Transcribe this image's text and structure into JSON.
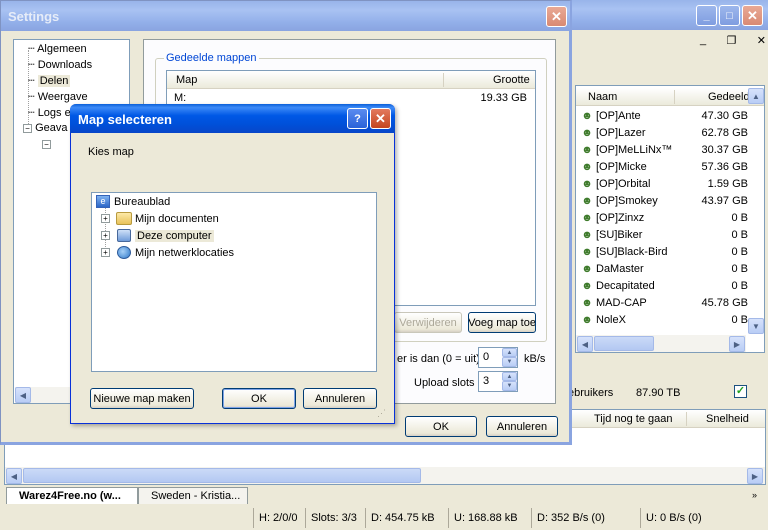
{
  "main_window": {
    "title": "",
    "minimize": "_",
    "maximize": "□",
    "close": "✕",
    "mdi": {
      "minimize": "_",
      "restore": "❐",
      "close": "✕"
    },
    "users_header": {
      "name": "Naam",
      "shared": "Gedeeld"
    },
    "users": [
      {
        "name": "[OP]Ante",
        "shared": "47.30 GB"
      },
      {
        "name": "[OP]Lazer",
        "shared": "62.78 GB"
      },
      {
        "name": "[OP]MeLLiNx™",
        "shared": "30.37 GB"
      },
      {
        "name": "[OP]Micke",
        "shared": "57.36 GB"
      },
      {
        "name": "[OP]Orbital",
        "shared": "1.59 GB"
      },
      {
        "name": "[OP]Smokey",
        "shared": "43.97 GB"
      },
      {
        "name": "[OP]Zinxz",
        "shared": "0 B"
      },
      {
        "name": "[SU]Biker",
        "shared": "0 B"
      },
      {
        "name": "[SU]Black-Bird",
        "shared": "0 B"
      },
      {
        "name": "DaMaster",
        "shared": "0 B"
      },
      {
        "name": "Decapitated",
        "shared": "0 B"
      },
      {
        "name": "MAD-CAP",
        "shared": "45.78 GB"
      },
      {
        "name": "NoleX",
        "shared": "0 B"
      }
    ],
    "hub_users_label": "ebruikers",
    "hub_total": "87.90 TB",
    "transfer_cols": {
      "time_left": "Tijd nog te gaan",
      "speed": "Snelheid"
    },
    "tabs": [
      "Warez4Free.no (w...",
      "Sweden - Kristia..."
    ],
    "status": {
      "hubs": "H: 2/0/0",
      "slots": "Slots: 3/3",
      "down": "D: 454.75 kB",
      "up": "U: 168.88 kB",
      "down_rate": "D: 352 B/s (0)",
      "up_rate": "U: 0 B/s (0)"
    }
  },
  "settings": {
    "title": "Settings",
    "nav": [
      "Algemeen",
      "Downloads",
      "Delen",
      "Weergave",
      "Logs e",
      "Geava"
    ],
    "shared_group": "Gedeelde mappen",
    "table_headers": {
      "map": "Map",
      "size": "Grootte"
    },
    "rows": [
      {
        "map": "M:",
        "size": "19.33 GB"
      }
    ],
    "remove_button": "Verwijderen",
    "add_button": "Voeg map toe",
    "speed_label": "er is dan (0 = uit)",
    "speed_value": "0",
    "speed_unit": "kB/s",
    "slots_label": "Upload slots",
    "slots_value": "3",
    "ok": "OK",
    "cancel": "Annuleren"
  },
  "dialog": {
    "title": "Map selecteren",
    "help": "?",
    "close": "✕",
    "prompt": "Kies map",
    "tree": [
      "Bureaublad",
      "Mijn documenten",
      "Deze computer",
      "Mijn netwerklocaties"
    ],
    "new_folder": "Nieuwe map maken",
    "ok": "OK",
    "cancel": "Annuleren"
  }
}
